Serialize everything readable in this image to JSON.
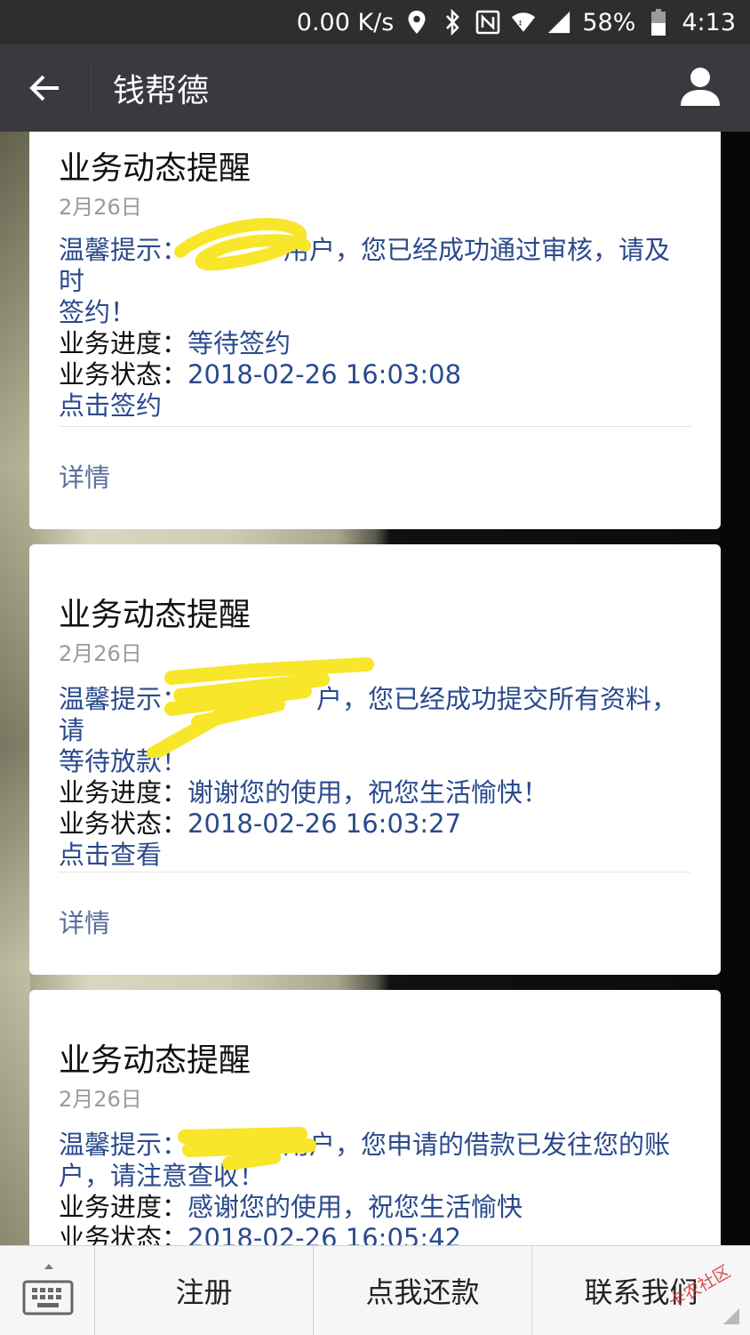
{
  "status_bar": {
    "net_speed": "0.00 K/s",
    "battery": "58%",
    "time": "4:13"
  },
  "header": {
    "title": "钱帮德"
  },
  "cards": [
    {
      "title": "业务动态提醒",
      "date": "2月26日",
      "tip_label": "温馨提示：",
      "tip_line1": "用户，您已经成功通过审核，请及时",
      "tip_line2": "签约！",
      "progress_label": "业务进度：",
      "progress_value": "等待签约",
      "status_label": "业务状态：",
      "status_value": "2018-02-26 16:03:08",
      "action": "点击签约",
      "detail": "详情"
    },
    {
      "title": "业务动态提醒",
      "date": "2月26日",
      "tip_label": "温馨提示：",
      "tip_line1": "户，您已经成功提交所有资料，请",
      "tip_line2": "等待放款！",
      "progress_label": "业务进度：",
      "progress_value": "谢谢您的使用，祝您生活愉快！",
      "status_label": "业务状态：",
      "status_value": "2018-02-26 16:03:27",
      "action": "点击查看",
      "detail": "详情"
    },
    {
      "title": "业务动态提醒",
      "date": "2月26日",
      "tip_label": "温馨提示：",
      "tip_line1": "用户，您申请的借款已发往您的账",
      "tip_line2": "户，请注意查收！",
      "progress_label": "业务进度：",
      "progress_value": "感谢您的使用，祝您生活愉快",
      "status_label": "业务状态：",
      "status_value": "2018-02-26 16:05:42"
    }
  ],
  "bottom_menu": {
    "items": [
      "注册",
      "点我还款",
      "联系我们"
    ]
  },
  "watermark": "卡农社区",
  "colors": {
    "header_bg": "#393a3f",
    "status_bg": "#2e2e2e",
    "link_blue": "#2a4a8c",
    "highlighter": "#f7e62a"
  },
  "icons": [
    "back-arrow-icon",
    "profile-icon",
    "keyboard-icon",
    "location-icon",
    "bluetooth-icon",
    "nfc-icon",
    "wifi-icon",
    "signal-icon",
    "battery-icon"
  ]
}
